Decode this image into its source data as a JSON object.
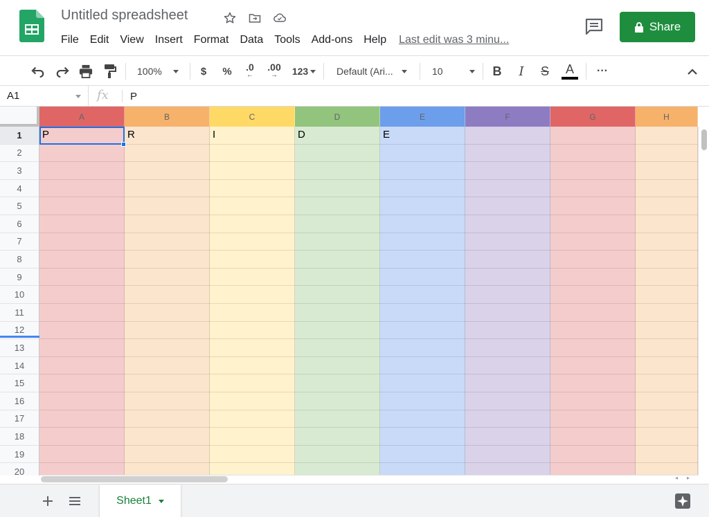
{
  "app": {
    "title": "Untitled spreadsheet",
    "share_label": "Share",
    "icons": [
      "spreadsheet-logo-icon",
      "star-icon",
      "move-to-folder-icon",
      "cloud-status-icon",
      "comment-icon",
      "lock-icon"
    ]
  },
  "menu": {
    "items": [
      "File",
      "Edit",
      "View",
      "Insert",
      "Format",
      "Data",
      "Tools",
      "Add-ons",
      "Help"
    ],
    "last_edit": "Last edit was 3 minu..."
  },
  "toolbar": {
    "zoom": "100%",
    "currency": "$",
    "percent": "%",
    "decrease_decimal": ".0",
    "increase_decimal": ".00",
    "more_formats": "123",
    "font": "Default (Ari...",
    "font_size": "10",
    "bold": "B",
    "italic": "I",
    "strikethrough": "S",
    "text_color": "A",
    "more": "···"
  },
  "formula_bar": {
    "cell_ref": "A1",
    "fx": "fx",
    "value": "P"
  },
  "grid": {
    "columns": [
      {
        "label": "A",
        "header_color": "#e06666",
        "fill_color": "#f4cccc"
      },
      {
        "label": "B",
        "header_color": "#f6b26b",
        "fill_color": "#fce5cd"
      },
      {
        "label": "C",
        "header_color": "#ffd966",
        "fill_color": "#fff2cc"
      },
      {
        "label": "D",
        "header_color": "#93c47d",
        "fill_color": "#d9ead3"
      },
      {
        "label": "E",
        "header_color": "#6d9eeb",
        "fill_color": "#c9daf8"
      },
      {
        "label": "F",
        "header_color": "#8e7cc3",
        "fill_color": "#d9d2e9"
      },
      {
        "label": "G",
        "header_color": "#e06666",
        "fill_color": "#f4cccc"
      },
      {
        "label": "H",
        "header_color": "#f6b26b",
        "fill_color": "#fce5cd"
      }
    ],
    "rows": [
      "1",
      "2",
      "3",
      "4",
      "5",
      "6",
      "7",
      "8",
      "9",
      "10",
      "11",
      "12",
      "13",
      "14",
      "15",
      "16",
      "17",
      "18",
      "19",
      "20"
    ],
    "row1_values": [
      "P",
      "R",
      "I",
      "D",
      "E",
      "",
      "",
      ""
    ],
    "selected_cell": "A1"
  },
  "sheets": {
    "tabs": [
      "Sheet1"
    ],
    "add_icon": "add-sheet-icon",
    "list_icon": "all-sheets-icon",
    "explore_icon": "explore-icon"
  }
}
